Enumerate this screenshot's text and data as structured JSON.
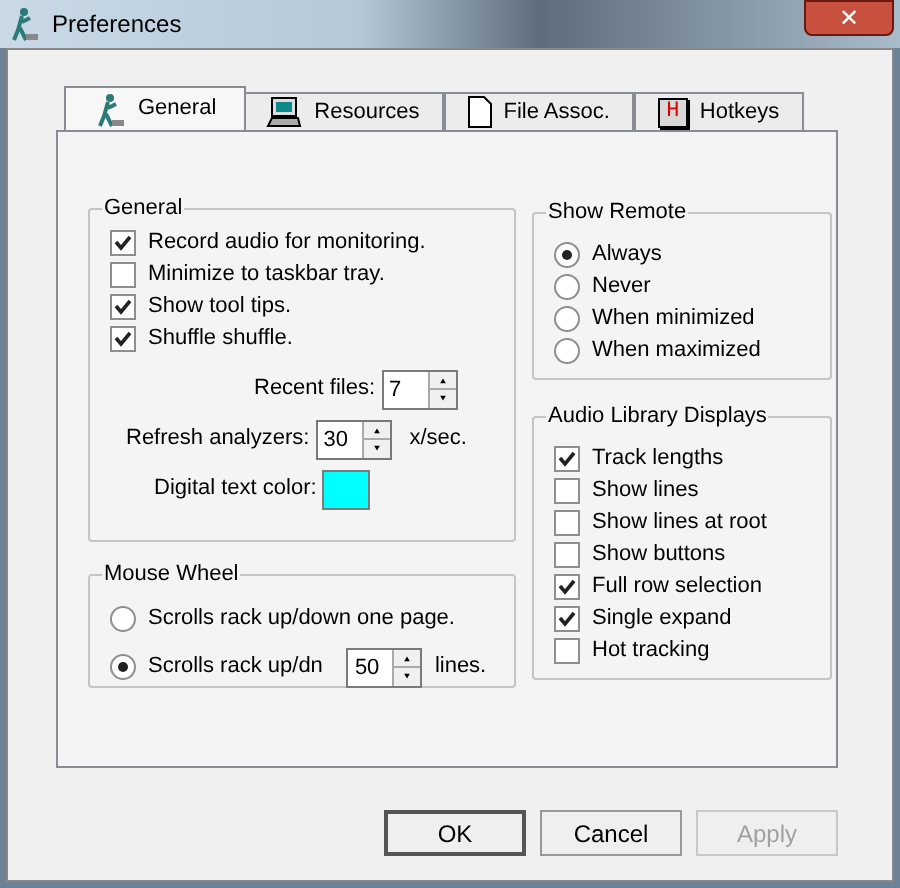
{
  "window": {
    "title": "Preferences",
    "close_label": "✕"
  },
  "tabs": [
    {
      "label": "General",
      "selected": true,
      "kind": "general"
    },
    {
      "label": "Resources",
      "selected": false,
      "kind": "resources"
    },
    {
      "label": "File Assoc.",
      "selected": false,
      "kind": "file"
    },
    {
      "label": "Hotkeys",
      "selected": false,
      "kind": "hotkeys",
      "icon_text": "H"
    }
  ],
  "general": {
    "title": "General",
    "options": [
      {
        "label": "Record audio for monitoring.",
        "checked": true
      },
      {
        "label": "Minimize to taskbar tray.",
        "checked": false
      },
      {
        "label": "Show tool tips.",
        "checked": true
      },
      {
        "label": "Shuffle shuffle.",
        "checked": true
      }
    ],
    "recent_files": {
      "label": "Recent files:",
      "value": "7"
    },
    "refresh_analyzers": {
      "label": "Refresh analyzers:",
      "value": "30",
      "unit": "x/sec."
    },
    "digital_text_color": {
      "label": "Digital text color:",
      "color": "#00ffff"
    }
  },
  "mouse_wheel": {
    "title": "Mouse Wheel",
    "options": [
      {
        "label": "Scrolls rack up/down one page.",
        "selected": false
      },
      {
        "label": "Scrolls rack up/dn",
        "selected": true,
        "value": "50",
        "unit": "lines."
      }
    ]
  },
  "show_remote": {
    "title": "Show Remote",
    "options": [
      {
        "label": "Always",
        "selected": true
      },
      {
        "label": "Never",
        "selected": false
      },
      {
        "label": "When minimized",
        "selected": false
      },
      {
        "label": "When maximized",
        "selected": false
      }
    ]
  },
  "audio_library_displays": {
    "title": "Audio Library Displays",
    "options": [
      {
        "label": "Track lengths",
        "checked": true
      },
      {
        "label": "Show lines",
        "checked": false
      },
      {
        "label": "Show lines at root",
        "checked": false
      },
      {
        "label": "Show buttons",
        "checked": false
      },
      {
        "label": "Full row selection",
        "checked": true
      },
      {
        "label": "Single expand",
        "checked": true
      },
      {
        "label": "Hot tracking",
        "checked": false
      }
    ]
  },
  "buttons": [
    {
      "label": "OK",
      "disabled": false,
      "default": true
    },
    {
      "label": "Cancel",
      "disabled": false,
      "default": false
    },
    {
      "label": "Apply",
      "disabled": true,
      "default": false
    }
  ]
}
